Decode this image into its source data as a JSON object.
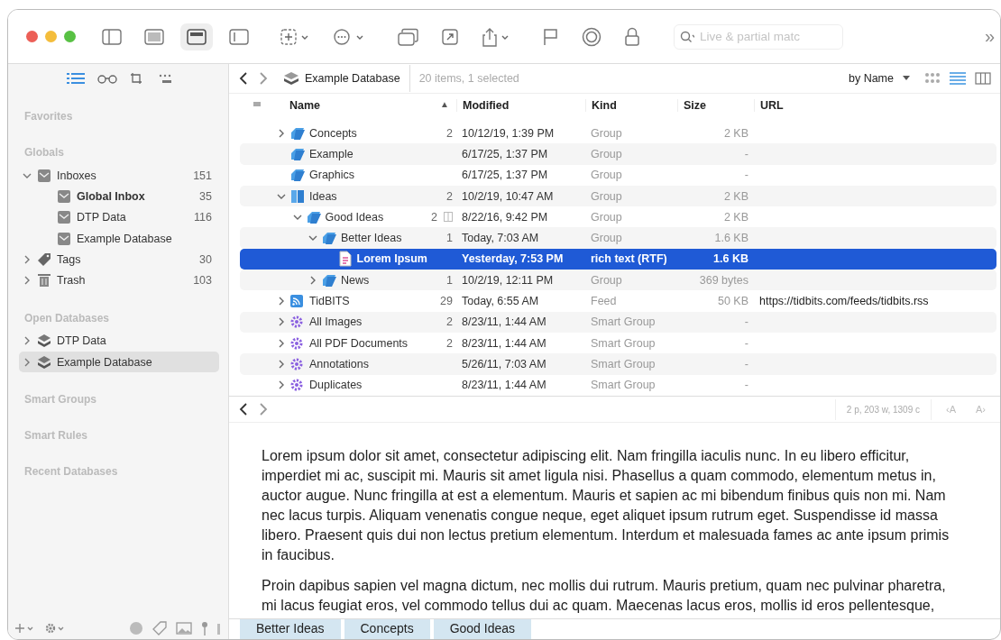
{
  "toolbar": {
    "search": {
      "placeholder": "Live & partial matc"
    },
    "overflow": "»"
  },
  "sidebar": {
    "sections": [
      {
        "title": "Favorites"
      },
      {
        "title": "Globals",
        "items": [
          {
            "label": "Inboxes",
            "count": "151",
            "kind": "inbox",
            "expanded": true,
            "selected": false,
            "children": [
              {
                "label": "Global Inbox",
                "count": "35",
                "kind": "inbox",
                "selected": false,
                "bold": true
              },
              {
                "label": "DTP Data",
                "count": "116",
                "kind": "inbox",
                "selected": false
              },
              {
                "label": "Example Database",
                "kind": "inbox",
                "selected": false
              }
            ]
          },
          {
            "label": "Tags",
            "count": "30",
            "kind": "tag",
            "expanded": false,
            "selected": false
          },
          {
            "label": "Trash",
            "count": "103",
            "kind": "trash",
            "expanded": false,
            "selected": false
          }
        ]
      },
      {
        "title": "Open Databases",
        "items": [
          {
            "label": "DTP Data",
            "kind": "database",
            "expanded": false,
            "selected": false
          },
          {
            "label": "Example Database",
            "kind": "database",
            "expanded": false,
            "selected": true
          }
        ]
      },
      {
        "title": "Smart Groups"
      },
      {
        "title": "Smart Rules"
      },
      {
        "title": "Recent Databases"
      }
    ]
  },
  "pathbar": {
    "database": "Example Database",
    "status": "20 items, 1 selected",
    "sort": "by Name"
  },
  "table": {
    "columns": [
      {
        "label": "Name",
        "sort": "▲"
      },
      {
        "label": "Modified"
      },
      {
        "label": "Kind"
      },
      {
        "label": "Size"
      },
      {
        "label": "URL"
      }
    ],
    "rows": [
      {
        "name": "Concepts",
        "kind": "group",
        "expanded": false,
        "count": "2",
        "modified": "10/12/19, 1:39 PM",
        "type": "Group",
        "size": "2 KB",
        "selected": false
      },
      {
        "name": "Example",
        "kind": "group",
        "modified": "6/17/25, 1:37 PM",
        "type": "Group",
        "size": "-",
        "selected": false
      },
      {
        "name": "Graphics",
        "kind": "group",
        "modified": "6/17/25, 1:37 PM",
        "type": "Group",
        "size": "-",
        "selected": false
      },
      {
        "name": "Ideas",
        "kind": "book",
        "expanded": true,
        "count": "2",
        "modified": "10/2/19, 10:47 AM",
        "type": "Group",
        "size": "2 KB",
        "selected": false,
        "children": [
          {
            "name": "Good Ideas",
            "kind": "group",
            "expanded": true,
            "count": "2",
            "columns_icon": true,
            "modified": "8/22/16, 9:42 PM",
            "type": "Group",
            "size": "2 KB",
            "selected": false,
            "children": [
              {
                "name": "Better Ideas",
                "kind": "group",
                "expanded": true,
                "count": "1",
                "modified": "Today, 7:03 AM",
                "type": "Group",
                "size": "1.6 KB",
                "selected": false,
                "children": [
                  {
                    "name": "Lorem Ipsum",
                    "kind": "rtf",
                    "modified": "Yesterday, 7:53 PM",
                    "type": "rich text (RTF)",
                    "size": "1.6 KB",
                    "selected": true
                  }
                ]
              },
              {
                "name": "News",
                "kind": "group",
                "expanded": false,
                "count": "1",
                "modified": "10/2/19, 12:11 PM",
                "type": "Group",
                "size": "369 bytes",
                "selected": false
              }
            ]
          }
        ]
      },
      {
        "name": "TidBITS",
        "kind": "feed",
        "expanded": false,
        "count": "29",
        "modified": "Today, 6:55 AM",
        "type": "Feed",
        "size": "50 KB",
        "url": "https://tidbits.com/feeds/tidbits.rss",
        "selected": false
      },
      {
        "name": "All Images",
        "kind": "smart",
        "expanded": false,
        "count": "2",
        "modified": "8/23/11, 1:44 AM",
        "type": "Smart Group",
        "size": "-",
        "selected": false
      },
      {
        "name": "All PDF Documents",
        "kind": "smart",
        "expanded": false,
        "count": "2",
        "modified": "8/23/11, 1:44 AM",
        "type": "Smart Group",
        "size": "-",
        "selected": false
      },
      {
        "name": "Annotations",
        "kind": "smart",
        "expanded": false,
        "modified": "5/26/11, 7:03 AM",
        "type": "Smart Group",
        "size": "-",
        "selected": false
      },
      {
        "name": "Duplicates",
        "kind": "smart",
        "expanded": false,
        "modified": "8/23/11, 1:44 AM",
        "type": "Smart Group",
        "size": "-",
        "selected": false
      }
    ]
  },
  "document": {
    "stats": "2 p, 203 w, 1309 c",
    "smaller": "‹A",
    "larger": "A›",
    "paragraphs": [
      "Lorem ipsum dolor sit amet, consectetur adipiscing elit. Nam fringilla iaculis nunc. In eu libero efficitur, imperdiet mi ac, suscipit mi. Mauris sit amet ligula nisi. Phasellus a quam commodo, elementum metus in, auctor augue. Nunc fringilla at est a elementum. Mauris et sapien ac mi bibendum finibus quis non mi. Nam nec lacus turpis. Aliquam venenatis congue neque, eget aliquet ipsum rutrum eget. Suspendisse id massa libero. Praesent quis dui non lectus pretium elementum. Interdum et malesuada fames ac ante ipsum primis in faucibus.",
      "Proin dapibus sapien vel magna dictum, nec mollis dui rutrum. Mauris pretium, quam nec pulvinar pharetra, mi lacus feugiat eros, vel commodo tellus dui ac quam. Maecenas lacus eros, mollis id eros pellentesque,"
    ]
  },
  "tabs": [
    {
      "label": "Better Ideas"
    },
    {
      "label": "Concepts"
    },
    {
      "label": "Good Ideas"
    }
  ]
}
